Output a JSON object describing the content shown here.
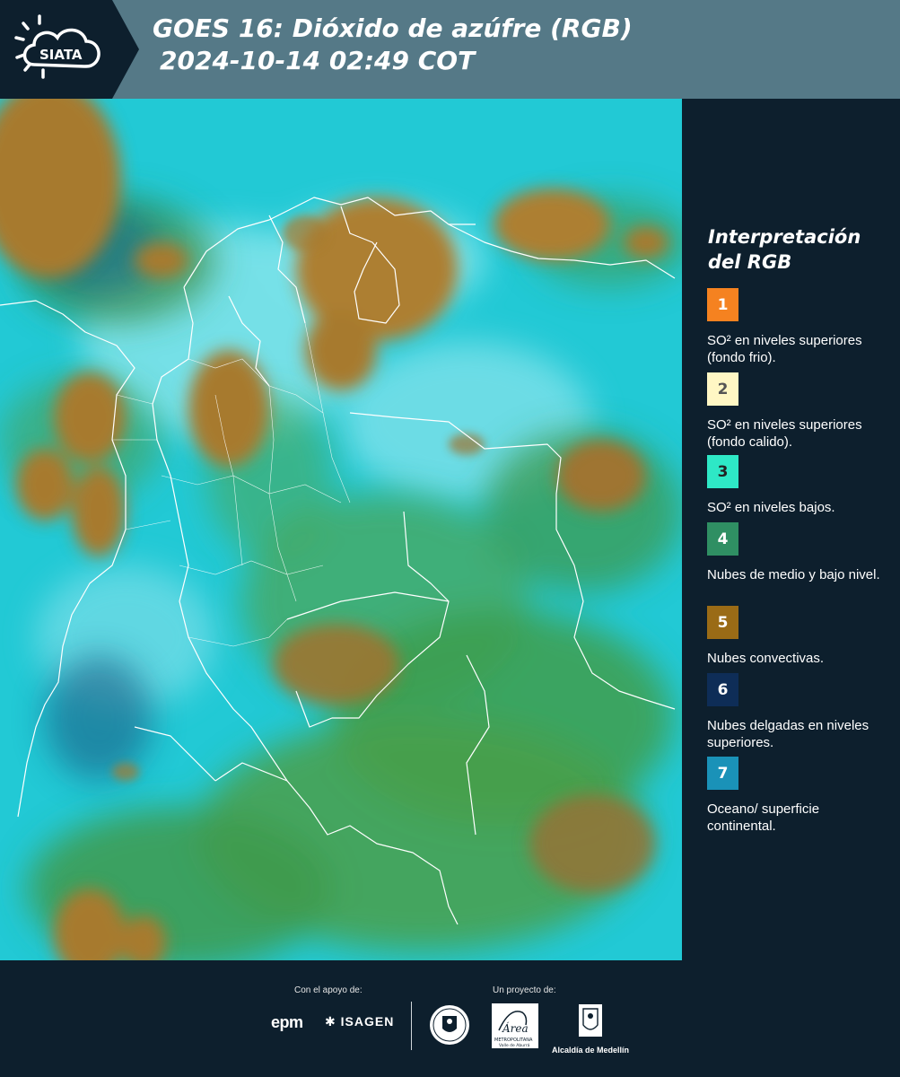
{
  "header": {
    "logo_text": "SIATA",
    "title_line1": "GOES 16: Dióxido de azúfre (RGB)",
    "title_line2": "2024-10-14 02:49 COT"
  },
  "legend": {
    "title_line1": "Interpretación",
    "title_line2": "del RGB",
    "items": [
      {
        "number": "1",
        "color": "#f58220",
        "text_color": "#ffffff",
        "label": "SO² en niveles superiores (fondo frio)."
      },
      {
        "number": "2",
        "color": "#fff7c4",
        "text_color": "#555555",
        "label": "SO² en niveles superiores (fondo calido)."
      },
      {
        "number": "3",
        "color": "#2ee8c6",
        "text_color": "#222222",
        "label": "SO² en niveles bajos."
      },
      {
        "number": "4",
        "color": "#2f8f63",
        "text_color": "#ffffff",
        "label": "Nubes de medio y bajo nivel."
      },
      {
        "number": "5",
        "color": "#9a6b16",
        "text_color": "#ffffff",
        "label": "Nubes convectivas."
      },
      {
        "number": "6",
        "color": "#0e2d57",
        "text_color": "#ffffff",
        "label": "Nubes delgadas en niveles superiores."
      },
      {
        "number": "7",
        "color": "#1a92b8",
        "text_color": "#ffffff",
        "label": "Oceano/ superficie continental."
      }
    ]
  },
  "footer": {
    "support_label": "Con el apoyo de:",
    "project_label": "Un proyecto de:",
    "epm": "epm",
    "isagen": "ISAGEN",
    "area_name": "Área",
    "area_sub": "METROPOLITANA",
    "area_sub2": "Valle de Aburrá",
    "alcaldia": "Alcaldía de Medellín"
  },
  "colors": {
    "background": "#0d1f2d",
    "header_band": "#557987",
    "map_cyan": "#1fc9d3",
    "map_green": "#3f9a4f",
    "map_brown": "#a4782e"
  }
}
